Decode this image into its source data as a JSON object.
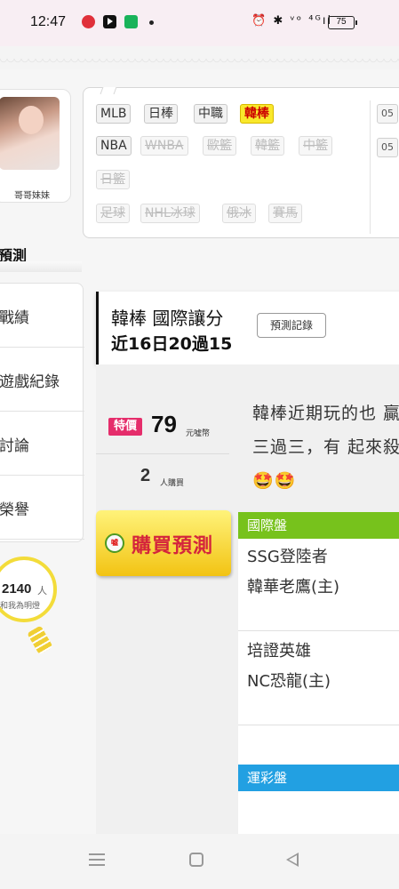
{
  "status_bar": {
    "time": "12:47",
    "indicators": "⏰ ✱ ᵛᵒ ⁴ᴳıl",
    "battery": "75",
    "icons": [
      "weibo-icon",
      "youtube-icon",
      "green-app-icon",
      "notification-dot-icon",
      "alarm-icon",
      "bluetooth-icon",
      "volte-icon",
      "signal-icon",
      "battery-icon"
    ]
  },
  "sidebar": {
    "profile_name": "哥哥妹妹",
    "predict_label": "預測",
    "menu": [
      {
        "label": "戰績"
      },
      {
        "label": "遊戲紀錄"
      },
      {
        "label": "討論"
      },
      {
        "label": "榮譽"
      }
    ],
    "light_count": "2140",
    "light_unit": "人",
    "light_text": "和我為明燈"
  },
  "filters": {
    "row1": [
      "MLB",
      "日棒",
      "中職",
      "韓棒"
    ],
    "row2": [
      "NBA",
      "WNBA",
      "歐籃",
      "韓籃",
      "中籃"
    ],
    "row3": [
      "日籃"
    ],
    "row4": [
      "足球",
      "NHL冰球",
      "俄冰",
      "賽馬"
    ],
    "active": "韓棒",
    "dates": [
      "05",
      "05"
    ]
  },
  "prediction": {
    "title": "韓棒 國際讓分",
    "record": "近16日20過15",
    "record_button": "預測記錄",
    "special_tag": "特價",
    "price": "79",
    "price_unit": "元噓幣",
    "buyers": "2",
    "buyers_unit": "人購買",
    "buy_icon_text": "噓",
    "buy_label": "購買預測",
    "comment": "韓棒近期玩的也 贏，三過三，有 起來殺豬🤩🤩",
    "market_international": "國際盤",
    "games": [
      {
        "team1": "SSG登陸者",
        "team2": "韓華老鷹(主)"
      },
      {
        "team1": "培證英雄",
        "team2": "NC恐龍(主)"
      }
    ],
    "market_lottery": "運彩盤"
  },
  "colors": {
    "active_tag": "#f9e82b",
    "special": "#e52d6b",
    "international": "#77c21c",
    "lottery": "#22a0e2",
    "buy": "#f2c313"
  }
}
